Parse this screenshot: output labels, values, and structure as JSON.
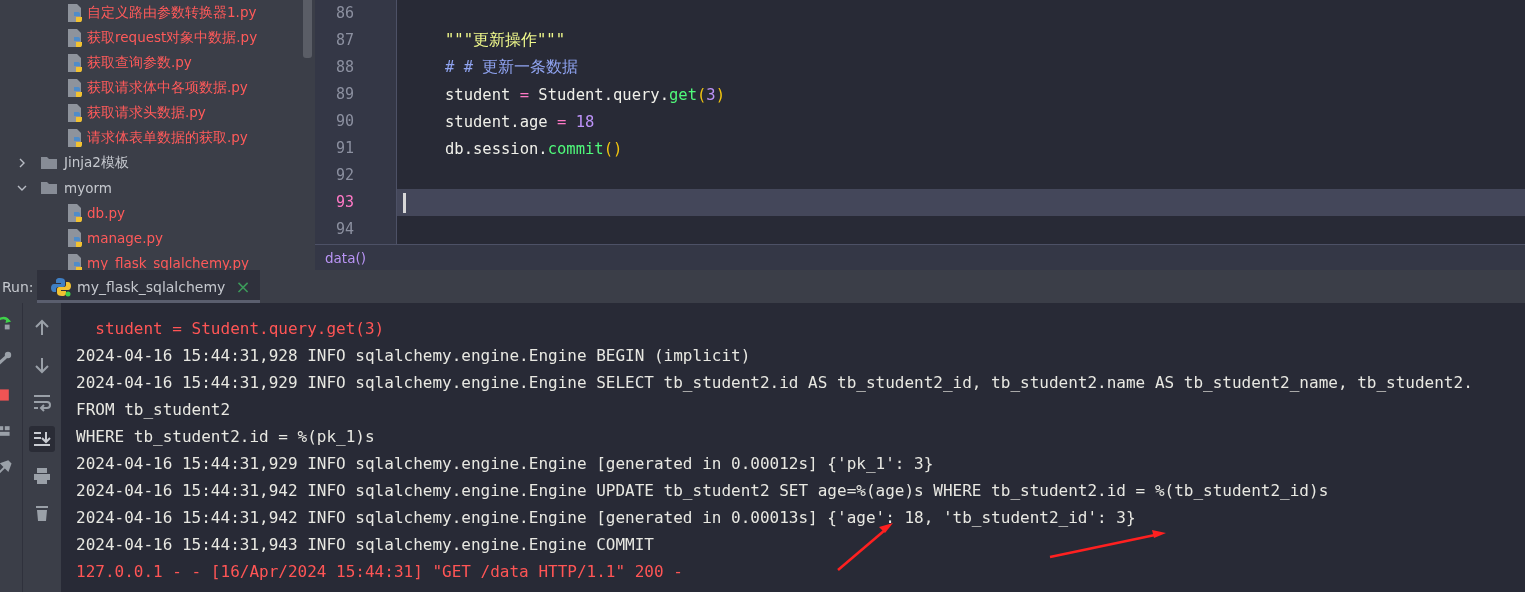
{
  "project_tree_continued": [
    {
      "kind": "file",
      "label": "自定义路由参数转换器1.py"
    },
    {
      "kind": "file",
      "label": "获取request对象中数据.py"
    },
    {
      "kind": "file",
      "label": "获取查询参数.py"
    },
    {
      "kind": "file",
      "label": "获取请求体中各项数据.py"
    },
    {
      "kind": "file",
      "label": "获取请求头数据.py"
    },
    {
      "kind": "file",
      "label": "请求体表单数据的获取.py"
    }
  ],
  "project_tree": [
    {
      "kind": "folder",
      "label": "Jinja2模板",
      "expanded": false
    },
    {
      "kind": "folder",
      "label": "myorm",
      "expanded": true,
      "children": [
        {
          "kind": "file",
          "label": "db.py"
        },
        {
          "kind": "file",
          "label": "manage.py"
        },
        {
          "kind": "file",
          "label": "my_flask_sqlalchemy.py"
        }
      ]
    }
  ],
  "editor": {
    "lines": [
      {
        "number": "86",
        "current": false
      },
      {
        "number": "87",
        "current": false,
        "tokens": [
          {
            "kind": "string",
            "text": "\"\"\"更新操作\"\"\""
          }
        ]
      },
      {
        "number": "88",
        "current": false,
        "tokens": [
          {
            "kind": "comment",
            "text": "# # 更新一条数据"
          }
        ]
      },
      {
        "number": "89",
        "current": false,
        "tokens": [
          {
            "kind": "plain",
            "text": "student "
          },
          {
            "kind": "operator",
            "text": "="
          },
          {
            "kind": "plain",
            "text": " Student.query."
          },
          {
            "kind": "function",
            "text": "get"
          },
          {
            "kind": "paren",
            "text": "("
          },
          {
            "kind": "number",
            "text": "3"
          },
          {
            "kind": "paren",
            "text": ")"
          }
        ]
      },
      {
        "number": "90",
        "current": false,
        "tokens": [
          {
            "kind": "plain",
            "text": "student.age "
          },
          {
            "kind": "operator",
            "text": "="
          },
          {
            "kind": "number",
            "text": " 18"
          }
        ]
      },
      {
        "number": "91",
        "current": false,
        "tokens": [
          {
            "kind": "plain",
            "text": "db.session."
          },
          {
            "kind": "function",
            "text": "commit"
          },
          {
            "kind": "paren",
            "text": "()"
          }
        ]
      },
      {
        "number": "92",
        "current": false
      },
      {
        "number": "93",
        "current": true
      },
      {
        "number": "94",
        "current": false
      }
    ],
    "breadcrumb": "data()"
  },
  "run_panel": {
    "label": "Run:",
    "tabs": [
      {
        "label": "my_flask_sqlalchemy",
        "selected": true,
        "close": "×"
      }
    ],
    "console": [
      {
        "kind": "error",
        "text": "  student = Student.query.get(3)"
      },
      {
        "kind": "plain",
        "text": "2024-04-16 15:44:31,928 INFO sqlalchemy.engine.Engine BEGIN (implicit)"
      },
      {
        "kind": "plain",
        "text": "2024-04-16 15:44:31,929 INFO sqlalchemy.engine.Engine SELECT tb_student2.id AS tb_student2_id, tb_student2.name AS tb_student2_name, tb_student2."
      },
      {
        "kind": "plain",
        "text": "FROM tb_student2"
      },
      {
        "kind": "plain",
        "text": "WHERE tb_student2.id = %(pk_1)s"
      },
      {
        "kind": "plain",
        "text": "2024-04-16 15:44:31,929 INFO sqlalchemy.engine.Engine [generated in 0.00012s] {'pk_1': 3}"
      },
      {
        "kind": "plain",
        "text": "2024-04-16 15:44:31,942 INFO sqlalchemy.engine.Engine UPDATE tb_student2 SET age=%(age)s WHERE tb_student2.id = %(tb_student2_id)s"
      },
      {
        "kind": "plain",
        "text": "2024-04-16 15:44:31,942 INFO sqlalchemy.engine.Engine [generated in 0.00013s] {'age': 18, 'tb_student2_id': 3}"
      },
      {
        "kind": "plain",
        "text": "2024-04-16 15:44:31,943 INFO sqlalchemy.engine.Engine COMMIT"
      },
      {
        "kind": "error",
        "text": "127.0.0.1 - - [16/Apr/2024 15:44:31] \"GET /data HTTP/1.1\" 200 -"
      }
    ]
  }
}
